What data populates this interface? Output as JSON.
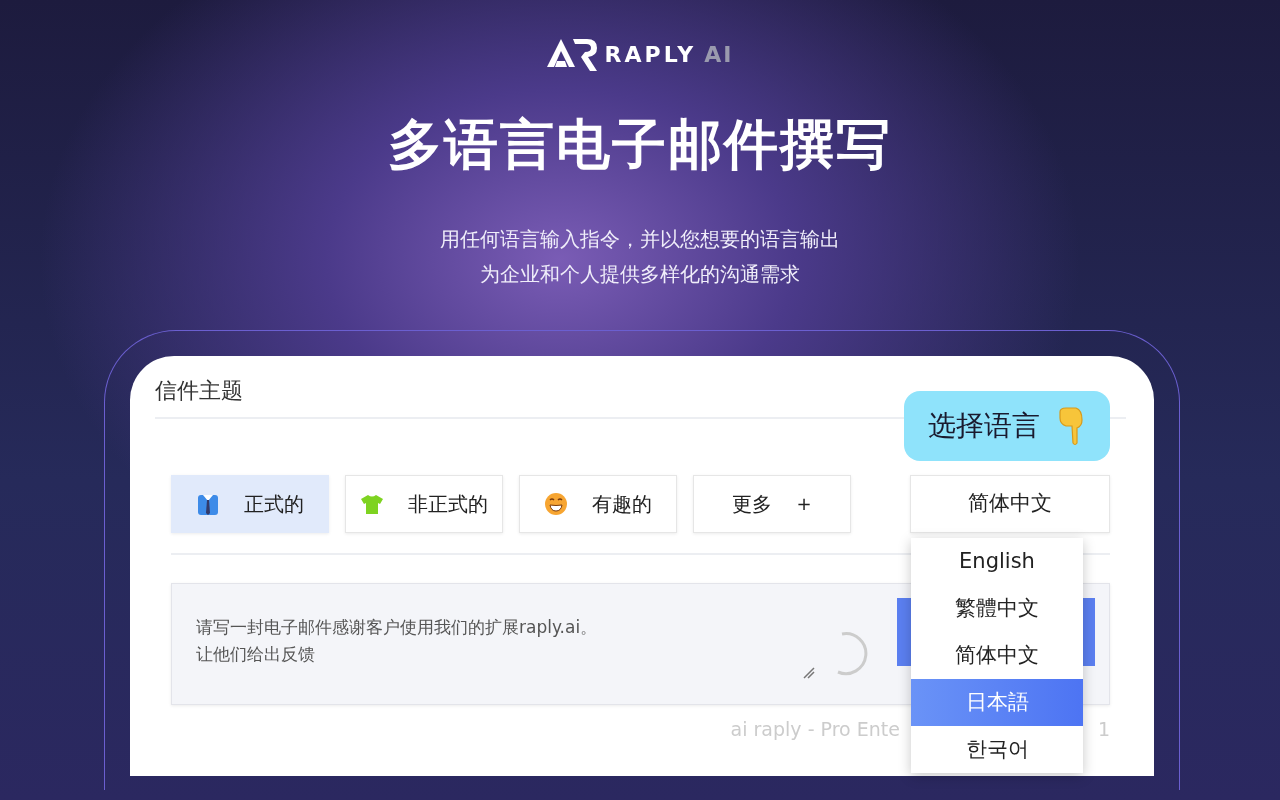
{
  "logo": {
    "name": "RAPLY",
    "suffix": "AI"
  },
  "headline": "多语言电子邮件撰写",
  "subtitle_lines": [
    "用任何语言输入指令，并以您想要的语言输出",
    "为企业和个人提供多样化的沟通需求"
  ],
  "editor": {
    "subject_label": "信件主题",
    "callout": "选择语言",
    "tones": [
      {
        "kind": "suit",
        "label": "正式的",
        "selected": true
      },
      {
        "kind": "tshirt",
        "label": "非正式的",
        "selected": false
      },
      {
        "kind": "grin",
        "label": "有趣的",
        "selected": false
      },
      {
        "kind": "more",
        "label": "更多",
        "selected": false
      }
    ],
    "more_symbol": "+",
    "language_select": {
      "value": "简体中文",
      "expanded": true
    },
    "language_options": [
      {
        "label": "English",
        "selected": false
      },
      {
        "label": "繁體中文",
        "selected": false
      },
      {
        "label": "简体中文",
        "selected": false
      },
      {
        "label": "日本語",
        "selected": true
      },
      {
        "label": "한국어",
        "selected": false
      }
    ],
    "prompt_lines": [
      "请写一封电子邮件感谢客户使用我们的扩展raply.ai。",
      "让他们给出反馈"
    ],
    "footer": [
      "ai raply - Pro Ente",
      "1"
    ]
  }
}
